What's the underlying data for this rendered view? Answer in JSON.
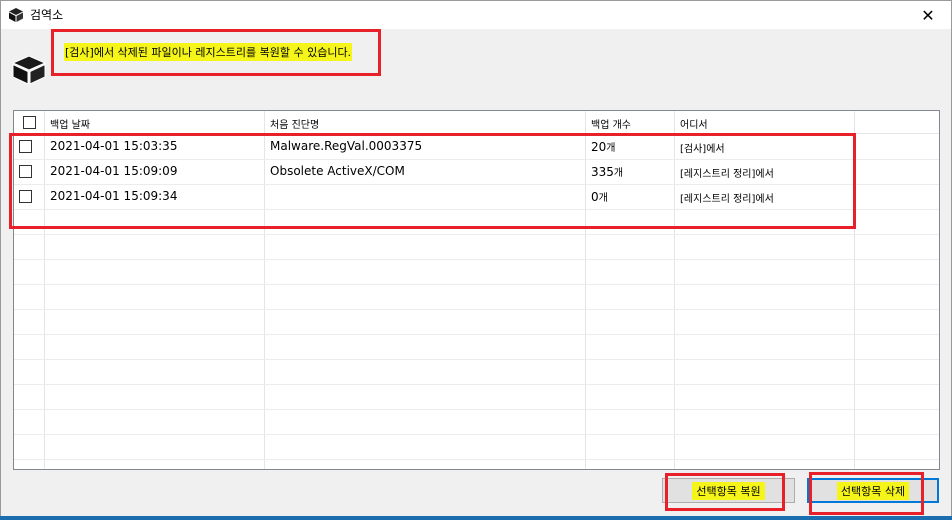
{
  "window": {
    "title": "검역소",
    "close_glyph": "✕"
  },
  "info": {
    "message": "[검사]에서 삭제된 파일이나 레지스트리를 복원할 수 있습니다."
  },
  "table": {
    "columns": [
      "백업 날짜",
      "처음 진단명",
      "백업 개수",
      "어디서"
    ],
    "rows": [
      {
        "date": "2021-04-01 15:03:35",
        "diagnosis": "Malware.RegVal.0003375",
        "count": "20",
        "count_unit": "개",
        "source": "[검사]에서"
      },
      {
        "date": "2021-04-01 15:09:09",
        "diagnosis": "Obsolete ActiveX/COM",
        "count": "335",
        "count_unit": "개",
        "source": "[레지스트리 정리]에서"
      },
      {
        "date": "2021-04-01 15:09:34",
        "diagnosis": "",
        "count": "0",
        "count_unit": "개",
        "source": "[레지스트리 정리]에서"
      }
    ]
  },
  "buttons": {
    "restore": "선택항목 복원",
    "delete": "선택항목 삭제"
  },
  "icons": {
    "app": "box-icon",
    "close": "close-icon"
  },
  "colors": {
    "highlight": "#f5f51a",
    "annotation_box": "#e8202a",
    "accent": "#0078d7"
  }
}
